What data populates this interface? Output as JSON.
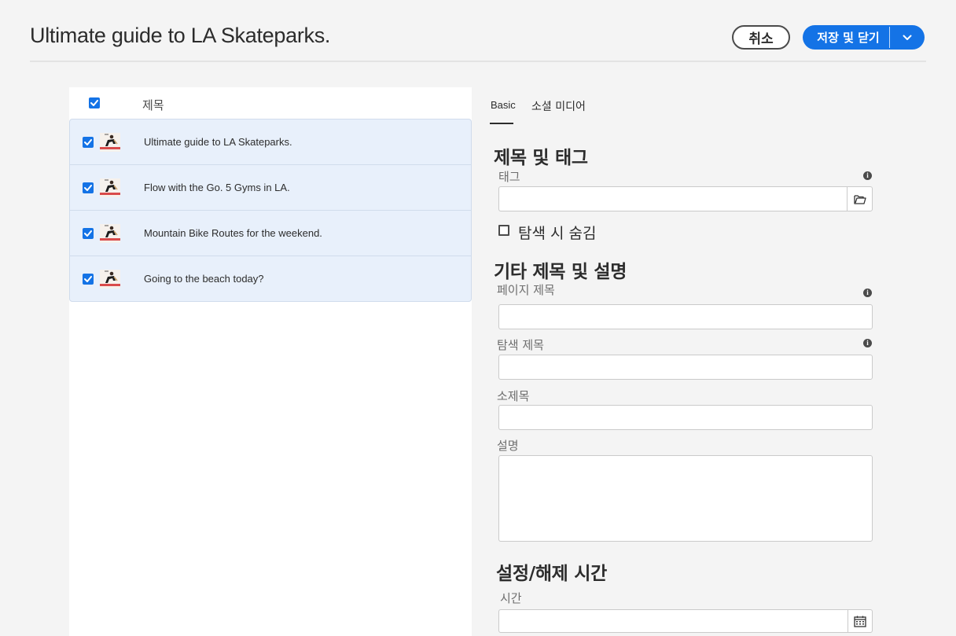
{
  "header": {
    "title": "Ultimate guide to LA Skateparks.",
    "cancel_label": "취소",
    "save_label": "저장 및 닫기"
  },
  "list": {
    "column_label": "제목",
    "items": [
      {
        "title": "Ultimate guide to LA Skateparks.",
        "checked": true
      },
      {
        "title": "Flow with the Go. 5 Gyms in LA.",
        "checked": true
      },
      {
        "title": "Mountain Bike Routes for the weekend.",
        "checked": true
      },
      {
        "title": "Going to the beach today?",
        "checked": true
      }
    ]
  },
  "tabs": [
    {
      "label": "Basic",
      "active": true
    },
    {
      "label": "소셜 미디어",
      "active": false
    }
  ],
  "sections": {
    "title_tags": {
      "heading": "제목 및 태그",
      "tags_label": "태그",
      "tags_value": "",
      "hide_in_nav_label": "탐색 시 숨김",
      "hide_in_nav_checked": false
    },
    "other_titles": {
      "heading": "기타 제목 및 설명",
      "page_title_label": "페이지 제목",
      "page_title_value": "",
      "nav_title_label": "탐색 제목",
      "nav_title_value": "",
      "subtitle_label": "소제목",
      "subtitle_value": "",
      "description_label": "설명",
      "description_value": ""
    },
    "on_off_time": {
      "heading": "설정/해제 시간",
      "time_label": "시간",
      "time_value": ""
    }
  },
  "colors": {
    "accent": "#1473e6",
    "selection_bg": "#e8f0fb",
    "page_bg": "#f4f4f4"
  },
  "icons": {
    "info": "info-icon",
    "folder": "folder-icon",
    "calendar": "calendar-icon",
    "dropdown": "chevron-down-icon",
    "checkbox": "checkmark-icon",
    "thumbnail": "skater-thumbnail-icon"
  }
}
